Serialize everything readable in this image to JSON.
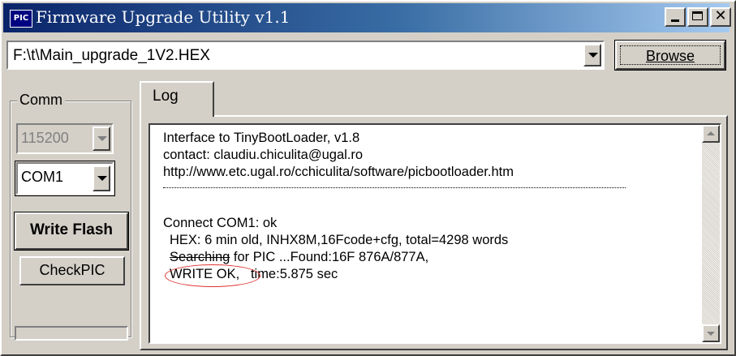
{
  "window": {
    "app_icon": "PIC",
    "title": "Firmware Upgrade Utility v1.1",
    "buttons": [
      "minimize-icon",
      "maximize-icon",
      "close-icon"
    ],
    "close_glyph": "✕"
  },
  "file": {
    "path": "F:\\t\\Main_upgrade_1V2.HEX",
    "browse_label": "Browse"
  },
  "comm": {
    "label": "Comm",
    "baud": "115200",
    "port": "COM1",
    "write_flash_label": "Write Flash",
    "checkpic_label": "CheckPIC"
  },
  "tabs": [
    {
      "label": "Log",
      "active": true
    }
  ],
  "log": {
    "header": [
      "Interface to TinyBootLoader, v1.8",
      "contact: claudiu.chiculita@ugal.ro",
      "http://www.etc.ugal.ro/cchiculita/software/picbootloader.htm"
    ],
    "connect": "Connect COM1: ok",
    "hex": "HEX: 6 min old, INHX8M,16Fcode+cfg, total=4298 words",
    "search_struck": "Searching",
    "search_rest": " for PIC ...Found:16F 876A/877A,",
    "write_ok": "WRITE OK,",
    "time": "time:5.875 sec"
  },
  "colors": {
    "titlebar_start": "#0a246a",
    "titlebar_end": "#a6caf0",
    "annotation": "#e03030"
  }
}
